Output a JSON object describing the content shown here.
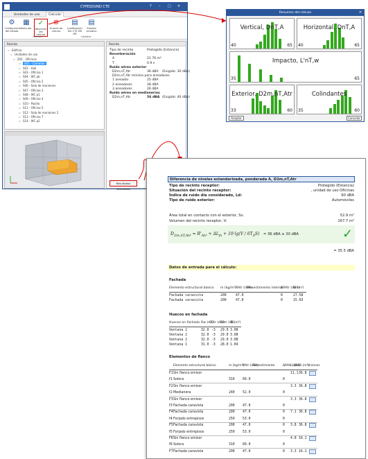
{
  "app": {
    "title": "CYPESOUND CTE",
    "window_controls": [
      "?",
      "–",
      "□",
      "✕"
    ]
  },
  "tabs": [
    "Unidades de uso",
    "Calcular"
  ],
  "ribbon": {
    "buttons": [
      {
        "label": "Configuración del listado",
        "icon": "gear-icon"
      },
      {
        "label": "Calcular",
        "icon": "calculator-icon"
      },
      {
        "label": "Resumen del cálculo",
        "icon": "summary-check-icon"
      },
      {
        "label": "Errores de cálculo",
        "icon": "error-icon"
      },
      {
        "label": "Justificación del CTE DB HR",
        "icon": "document-icon"
      },
      {
        "label": "Estudio acústico",
        "icon": "document-icon"
      }
    ],
    "groups": [
      "Cálculo",
      "Listados"
    ]
  },
  "tree": {
    "header": "Recinto",
    "items": [
      "Edificio",
      "Unidades de uso",
      "Z01 - Oficinas",
      "S01 - Comedor",
      "S02 - Hall",
      "S03 - Oficina 1",
      "S04 - WC pb",
      "S05 - Oficina 2",
      "S06 - Sala de reuniones",
      "S07 - Oficina 3",
      "S08 - WC p1",
      "S09 - Oficina 4",
      "S10 - Pasillo",
      "S11 - Oficina 5",
      "S12 - Sala de reuniones 2",
      "S13 - Oficina 7",
      "S14 - WC p2"
    ],
    "selected_index": 3
  },
  "recinto": {
    "header": "Recinto",
    "rows": [
      {
        "label": "Tipo de recinto",
        "value": "Protegido (Estancia)",
        "bold": false
      },
      {
        "label": "Reverberación",
        "value": "",
        "bold": true
      },
      {
        "label": "A",
        "value": "21.76 m²",
        "bold": false
      },
      {
        "label": "T",
        "value": "0.9 s",
        "bold": false
      },
      {
        "label": "Ruido aéreo exterior",
        "value": "",
        "bold": true
      },
      {
        "label": "D2m,nT,Atr",
        "value": "36 dBA",
        "extra": "(Exigido: 30 dBA)",
        "bold": false
      },
      {
        "label": "D2m,nT,Atr mínimo para aireadores",
        "value": "",
        "bold": false
      },
      {
        "label": "1 aireador",
        "value": "25 dBA",
        "bold": false
      },
      {
        "label": "2 aireadores",
        "value": "28 dBA",
        "bold": false
      },
      {
        "label": "3 aireadores",
        "value": "26 dBA",
        "bold": false
      },
      {
        "label": "Ruido aéreo en medianerías",
        "value": "",
        "bold": true
      },
      {
        "label": "D2m,nT,Atr",
        "value": "56 dBA",
        "extra": "(Exigido: 40 dBA)",
        "bold": false
      }
    ],
    "results_button": "Resultados detallados"
  },
  "summary": {
    "title": "Resumen del cálculo",
    "panels": [
      {
        "label": "Vertical, DnT,A",
        "min": "40",
        "max": "65"
      },
      {
        "label": "Horizontal, DnT,A",
        "min": "40",
        "max": "65"
      },
      {
        "label": "Impacto, L'nT,w",
        "min": "35",
        "max": "65"
      },
      {
        "label": "Exterior, D2m,nT,Atr",
        "min": "33",
        "max": "60"
      },
      {
        "label": "Colindantes",
        "min": "35",
        "max": "60"
      }
    ],
    "accept": "Aceptar",
    "cancel": "Cancelar"
  },
  "report": {
    "title": "Diferencia de niveles estandarizada, ponderada A, D2m,nT,Atr",
    "info": [
      {
        "label": "Tipo de recinto receptor:",
        "value": "Protegido (Estancia)"
      },
      {
        "label": "Situación del recinto receptor:",
        "value": ", unidad de uso Oficinas"
      },
      {
        "label": "Índice de ruido día considerado, Ld:",
        "value": "60 dBA"
      },
      {
        "label": "Tipo de ruido exterior:",
        "value": "Automóviles"
      }
    ],
    "area_label": "Área total en contacto con el exterior, Ss:",
    "area_value": "52.9 m²",
    "volume_label": "Volumen del recinto receptor, V:",
    "volume_value": "167.7 m³",
    "formula_result": "= 36 dBA ≥ 30 dBA",
    "approx": "= 35.5 dBA",
    "input_title": "Datos de entrada para el cálculo:",
    "facade": {
      "title": "Fachada",
      "headers": [
        "Elemento estructural básico",
        "m (kg/m²)",
        "RAtr (dBA)",
        "Revestimiento interior",
        "ΔRAtr (dBA)",
        "Si (m²)"
      ],
      "rows": [
        [
          "Fachada caravista",
          "200",
          "47.0",
          "",
          "0",
          "27.58"
        ],
        [
          "Fachada caravista",
          "200",
          "47.0",
          "",
          "0",
          "15.03"
        ]
      ]
    },
    "openings": {
      "title": "Huecos en fachada",
      "headers": [
        "Huecos en fachada",
        "Rw (dB)",
        "Ctr (dB)",
        "RAtr (dB)",
        "Si (m²)"
      ],
      "rows": [
        [
          "Ventana 2",
          "32.0",
          "-3",
          "29.0",
          "3.08"
        ],
        [
          "Ventana 2",
          "32.0",
          "-3",
          "29.0",
          "3.08"
        ],
        [
          "Ventana 2",
          "32.0",
          "-3",
          "29.0",
          "3.08"
        ],
        [
          "Ventana 1",
          "31.0",
          "-3",
          "28.0",
          "1.04"
        ]
      ]
    },
    "flanking": {
      "title": "Elementos de flanco",
      "headers": [
        "Elemento estructural básico",
        "m (kg/m²)",
        "RAtr (dBA)",
        "Revestimiento",
        "ΔRAtr (dBA)",
        "Li (m)",
        "Si (m²)",
        "Uniones"
      ],
      "rows": [
        {
          "code": "F1",
          "a": "Sin flanco emisor",
          "b": "",
          "c": "",
          "d": "",
          "li": "11.1",
          "si": "36.8"
        },
        {
          "code": "f1",
          "a": "Solera",
          "b": "310",
          "c": "60.0",
          "d": "0",
          "li": "",
          "si": ""
        },
        {
          "code": "F2",
          "a": "Sin flanco emisor",
          "b": "",
          "c": "",
          "d": "",
          "li": "3.3",
          "si": "36.8"
        },
        {
          "code": "f2",
          "a": "Medianera",
          "b": "240",
          "c": "52.0",
          "d": "0",
          "li": "",
          "si": ""
        },
        {
          "code": "F3",
          "a": "Sin flanco emisor",
          "b": "",
          "c": "",
          "d": "",
          "li": "3.3",
          "si": "36.8"
        },
        {
          "code": "f3",
          "a": "Fachada caravista",
          "b": "200",
          "c": "47.0",
          "d": "0",
          "li": "",
          "si": ""
        },
        {
          "code": "F4",
          "a": "Fachada caravista",
          "b": "200",
          "c": "47.0",
          "d": "0",
          "li": "7.1",
          "si": "36.8"
        },
        {
          "code": "f4",
          "a": "Forjado entrepisos",
          "b": "250",
          "c": "53.0",
          "d": "0",
          "li": "",
          "si": ""
        },
        {
          "code": "F5",
          "a": "Fachada caravista",
          "b": "200",
          "c": "47.0",
          "d": "0",
          "li": "3.8",
          "si": "36.8"
        },
        {
          "code": "f5",
          "a": "Forjado entrepisos",
          "b": "250",
          "c": "53.0",
          "d": "0",
          "li": "",
          "si": ""
        },
        {
          "code": "F6",
          "a": "Sin flanco emisor",
          "b": "",
          "c": "",
          "d": "",
          "li": "4.8",
          "si": "16.1"
        },
        {
          "code": "f6",
          "a": "Solera",
          "b": "310",
          "c": "60.0",
          "d": "0",
          "li": "",
          "si": ""
        },
        {
          "code": "F7",
          "a": "Fachada caravista",
          "b": "200",
          "c": "47.0",
          "d": "0",
          "li": "3.3",
          "si": "16.1"
        }
      ]
    }
  },
  "colors": {
    "accent": "#2b579a",
    "bar_green": "#33a81e",
    "highlight_red": "#cc0000",
    "check_green": "#2ea32e"
  }
}
